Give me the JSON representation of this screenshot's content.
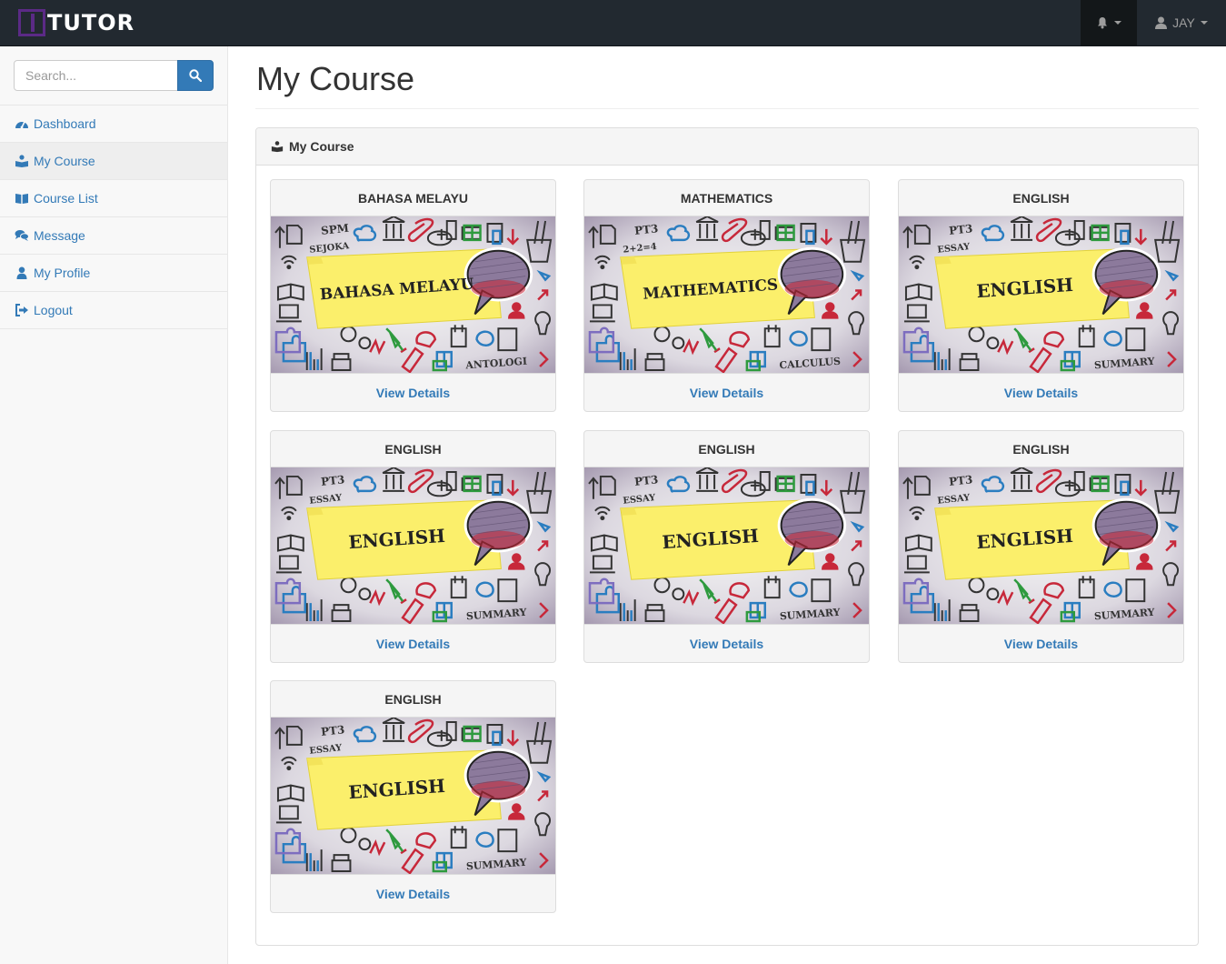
{
  "navbar": {
    "brand": "TUTOR",
    "user_name": "JAY"
  },
  "sidebar": {
    "search_placeholder": "Search...",
    "items": [
      {
        "label": "Dashboard",
        "icon": "dashboard-icon"
      },
      {
        "label": "My Course",
        "icon": "user-book-icon",
        "active": true
      },
      {
        "label": "Course List",
        "icon": "book-icon"
      },
      {
        "label": "Message",
        "icon": "comments-icon"
      },
      {
        "label": "My Profile",
        "icon": "user-icon"
      },
      {
        "label": "Logout",
        "icon": "sign-out-icon"
      }
    ]
  },
  "main": {
    "page_title": "My Course",
    "panel_title": "My Course",
    "courses": [
      {
        "title": "BAHASA MELAYU",
        "banner_text": "BAHASA MELAYU",
        "tag_top": "SPM",
        "tag_top2": "SEJOKA",
        "tag_bottom": "ANTOLOGI",
        "link": "View Details"
      },
      {
        "title": "MATHEMATICS",
        "banner_text": "MATHEMATICS",
        "tag_top": "PT3",
        "tag_top2": "2+2=4",
        "tag_bottom": "CALCULUS",
        "link": "View Details"
      },
      {
        "title": "ENGLISH",
        "banner_text": "ENGLISH",
        "tag_top": "PT3",
        "tag_top2": "ESSAY",
        "tag_bottom": "SUMMARY",
        "link": "View Details"
      },
      {
        "title": "ENGLISH",
        "banner_text": "ENGLISH",
        "tag_top": "PT3",
        "tag_top2": "ESSAY",
        "tag_bottom": "SUMMARY",
        "link": "View Details"
      },
      {
        "title": "ENGLISH",
        "banner_text": "ENGLISH",
        "tag_top": "PT3",
        "tag_top2": "ESSAY",
        "tag_bottom": "SUMMARY",
        "link": "View Details"
      },
      {
        "title": "ENGLISH",
        "banner_text": "ENGLISH",
        "tag_top": "PT3",
        "tag_top2": "ESSAY",
        "tag_bottom": "SUMMARY",
        "link": "View Details"
      },
      {
        "title": "ENGLISH",
        "banner_text": "ENGLISH",
        "tag_top": "PT3",
        "tag_top2": "ESSAY",
        "tag_bottom": "SUMMARY",
        "link": "View Details"
      }
    ]
  },
  "colors": {
    "navbar_bg": "#222930",
    "link": "#337ab7",
    "note_yellow": "#fbef6b",
    "bubble_purple": "#8c7a9c"
  }
}
